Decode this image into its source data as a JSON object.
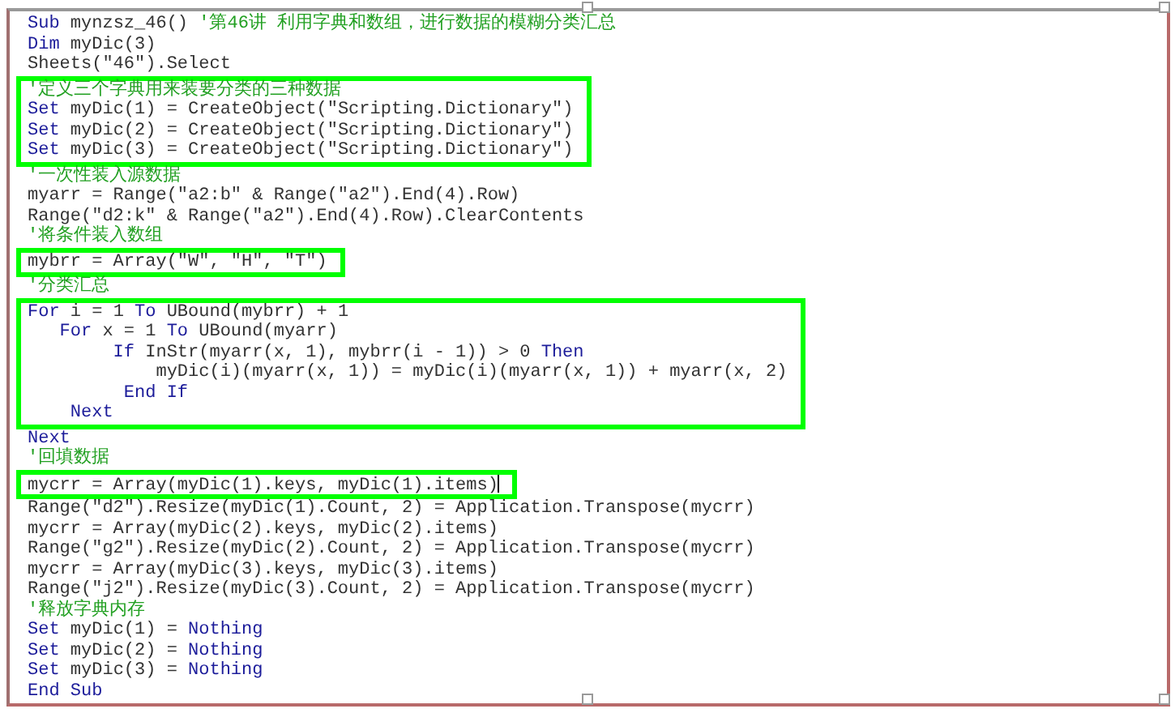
{
  "editor": {
    "blocks": [
      {
        "highlighted": false,
        "lines": [
          {
            "segments": [
              {
                "kind": "keyword",
                "text": "Sub"
              },
              {
                "kind": "plain",
                "text": " mynzsz_46() "
              },
              {
                "kind": "comment",
                "text": "'第46讲 利用字典和数组，进行数据的模糊分类汇总"
              }
            ]
          },
          {
            "segments": [
              {
                "kind": "keyword",
                "text": "Dim"
              },
              {
                "kind": "plain",
                "text": " myDic(3)"
              }
            ]
          },
          {
            "segments": [
              {
                "kind": "plain",
                "text": "Sheets(\"46\").Select"
              }
            ]
          }
        ]
      },
      {
        "highlighted": true,
        "lines": [
          {
            "segments": [
              {
                "kind": "comment",
                "text": "'定义三个字典用来装要分类的三种数据"
              }
            ]
          },
          {
            "segments": [
              {
                "kind": "keyword",
                "text": "Set"
              },
              {
                "kind": "plain",
                "text": " myDic(1) = CreateObject(\"Scripting.Dictionary\")"
              }
            ]
          },
          {
            "segments": [
              {
                "kind": "keyword",
                "text": "Set"
              },
              {
                "kind": "plain",
                "text": " myDic(2) = CreateObject(\"Scripting.Dictionary\")"
              }
            ]
          },
          {
            "segments": [
              {
                "kind": "keyword",
                "text": "Set"
              },
              {
                "kind": "plain",
                "text": " myDic(3) = CreateObject(\"Scripting.Dictionary\")"
              }
            ]
          }
        ]
      },
      {
        "highlighted": false,
        "lines": [
          {
            "segments": [
              {
                "kind": "comment",
                "text": "'一次性装入源数据"
              }
            ]
          },
          {
            "segments": [
              {
                "kind": "plain",
                "text": "myarr = Range(\"a2:b\" & Range(\"a2\").End(4).Row)"
              }
            ]
          },
          {
            "segments": [
              {
                "kind": "plain",
                "text": "Range(\"d2:k\" & Range(\"a2\").End(4).Row).ClearContents"
              }
            ]
          },
          {
            "segments": [
              {
                "kind": "comment",
                "text": "'将条件装入数组"
              }
            ]
          }
        ]
      },
      {
        "highlighted": true,
        "lines": [
          {
            "segments": [
              {
                "kind": "plain",
                "text": "mybrr = Array(\"W\", \"H\", \"T\")"
              }
            ]
          }
        ]
      },
      {
        "highlighted": false,
        "lines": [
          {
            "segments": [
              {
                "kind": "comment",
                "text": "'分类汇总"
              }
            ]
          }
        ]
      },
      {
        "highlighted": true,
        "lines": [
          {
            "segments": [
              {
                "kind": "keyword",
                "text": "For"
              },
              {
                "kind": "plain",
                "text": " i = 1 "
              },
              {
                "kind": "keyword",
                "text": "To"
              },
              {
                "kind": "plain",
                "text": " UBound(mybrr) + 1"
              }
            ]
          },
          {
            "segments": [
              {
                "kind": "keyword",
                "text": "   For"
              },
              {
                "kind": "plain",
                "text": " x = 1 "
              },
              {
                "kind": "keyword",
                "text": "To"
              },
              {
                "kind": "plain",
                "text": " UBound(myarr)"
              }
            ]
          },
          {
            "segments": [
              {
                "kind": "keyword",
                "text": "        If"
              },
              {
                "kind": "plain",
                "text": " InStr(myarr(x, 1), mybrr(i - 1)) > 0 "
              },
              {
                "kind": "keyword",
                "text": "Then"
              }
            ]
          },
          {
            "segments": [
              {
                "kind": "plain",
                "text": "            myDic(i)(myarr(x, 1)) = myDic(i)(myarr(x, 1)) + myarr(x, 2)"
              }
            ]
          },
          {
            "segments": [
              {
                "kind": "keyword",
                "text": "         End If"
              }
            ]
          },
          {
            "segments": [
              {
                "kind": "keyword",
                "text": "    Next"
              }
            ]
          }
        ]
      },
      {
        "highlighted": false,
        "lines": [
          {
            "segments": [
              {
                "kind": "keyword",
                "text": "Next"
              }
            ]
          },
          {
            "segments": [
              {
                "kind": "comment",
                "text": "'回填数据"
              }
            ]
          }
        ]
      },
      {
        "highlighted": true,
        "lines": [
          {
            "segments": [
              {
                "kind": "plain",
                "text": "mycrr = Array(myDic(1).keys, myDic(1).items)"
              }
            ],
            "cursor": true
          }
        ]
      },
      {
        "highlighted": false,
        "lines": [
          {
            "segments": [
              {
                "kind": "plain",
                "text": "Range(\"d2\").Resize(myDic(1).Count, 2) = Application.Transpose(mycrr)"
              }
            ]
          },
          {
            "segments": [
              {
                "kind": "plain",
                "text": "mycrr = Array(myDic(2).keys, myDic(2).items)"
              }
            ]
          },
          {
            "segments": [
              {
                "kind": "plain",
                "text": "Range(\"g2\").Resize(myDic(2).Count, 2) = Application.Transpose(mycrr)"
              }
            ]
          },
          {
            "segments": [
              {
                "kind": "plain",
                "text": "mycrr = Array(myDic(3).keys, myDic(3).items)"
              }
            ]
          },
          {
            "segments": [
              {
                "kind": "plain",
                "text": "Range(\"j2\").Resize(myDic(3).Count, 2) = Application.Transpose(mycrr)"
              }
            ]
          },
          {
            "segments": [
              {
                "kind": "comment",
                "text": "'释放字典内存"
              }
            ]
          },
          {
            "segments": [
              {
                "kind": "keyword",
                "text": "Set"
              },
              {
                "kind": "plain",
                "text": " myDic(1) = "
              },
              {
                "kind": "keyword",
                "text": "Nothing"
              }
            ]
          },
          {
            "segments": [
              {
                "kind": "keyword",
                "text": "Set"
              },
              {
                "kind": "plain",
                "text": " myDic(2) = "
              },
              {
                "kind": "keyword",
                "text": "Nothing"
              }
            ]
          },
          {
            "segments": [
              {
                "kind": "keyword",
                "text": "Set"
              },
              {
                "kind": "plain",
                "text": " myDic(3) = "
              },
              {
                "kind": "keyword",
                "text": "Nothing"
              }
            ]
          },
          {
            "segments": [
              {
                "kind": "keyword",
                "text": "End Sub"
              }
            ]
          }
        ]
      }
    ]
  }
}
